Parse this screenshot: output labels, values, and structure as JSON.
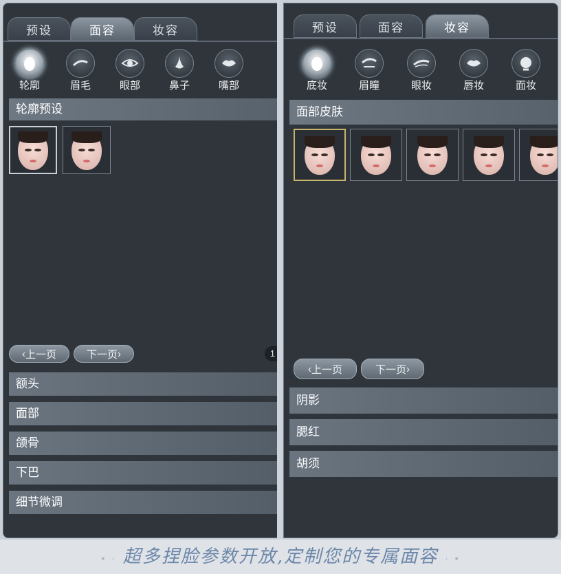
{
  "left": {
    "tabs": [
      {
        "label": "预设",
        "active": false
      },
      {
        "label": "面容",
        "active": true
      },
      {
        "label": "妆容",
        "active": false
      }
    ],
    "icons": [
      {
        "label": "轮廓",
        "icon": "face-outline-icon",
        "active": true
      },
      {
        "label": "眉毛",
        "icon": "eyebrow-icon",
        "active": false
      },
      {
        "label": "眼部",
        "icon": "eye-icon",
        "active": false
      },
      {
        "label": "鼻子",
        "icon": "nose-icon",
        "active": false
      },
      {
        "label": "嘴部",
        "icon": "lips-icon",
        "active": false
      }
    ],
    "section_title": "轮廓预设",
    "thumbnails": 2,
    "pager": {
      "prev": "上一页",
      "next": "下一页",
      "page": "1"
    },
    "rows": [
      "额头",
      "面部",
      "颌骨",
      "下巴",
      "细节微调"
    ]
  },
  "right": {
    "tabs": [
      {
        "label": "预设",
        "active": false
      },
      {
        "label": "面容",
        "active": false
      },
      {
        "label": "妆容",
        "active": true
      }
    ],
    "icons": [
      {
        "label": "底妆",
        "icon": "foundation-icon",
        "active": true
      },
      {
        "label": "眉瞳",
        "icon": "brow-pupil-icon",
        "active": false
      },
      {
        "label": "眼妆",
        "icon": "eye-makeup-icon",
        "active": false
      },
      {
        "label": "唇妆",
        "icon": "lip-makeup-icon",
        "active": false
      },
      {
        "label": "面妆",
        "icon": "face-paint-icon",
        "active": false
      }
    ],
    "section_title": "面部皮肤",
    "thumbnails": 5,
    "pager": {
      "prev": "上一页",
      "next": "下一页"
    },
    "rows": [
      "阴影",
      "腮红",
      "胡须"
    ]
  },
  "caption": "超多捏脸参数开放,定制您的专属面容",
  "colors": {
    "panel": "#2f353b",
    "accent_gold": "#c8b46a",
    "caption": "#6b86a8"
  }
}
